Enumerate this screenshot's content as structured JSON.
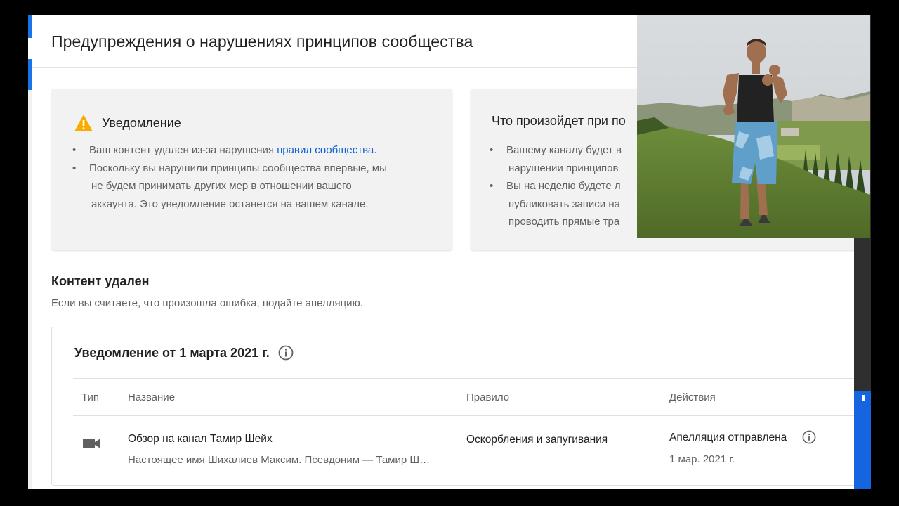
{
  "dialog": {
    "title": "Предупреждения о нарушениях принципов сообщества"
  },
  "notice_card": {
    "heading": "Уведомление",
    "bullet1_prefix": "Ваш контент удален из-за нарушения ",
    "bullet1_link": "правил сообщества",
    "bullet1_suffix": ".",
    "bullet2_line1": "Поскольку вы нарушили принципы сообщества впервые, мы",
    "bullet2_line2": "не будем принимать других мер в отношении вашего",
    "bullet2_line3": "аккаунта. Это уведомление останется на вашем канале."
  },
  "what_card": {
    "heading": "Что произойдет при по",
    "bullet1_line1": "Вашему каналу будет в",
    "bullet1_line2": "нарушении принципов",
    "bullet2_line1": "Вы на неделю будете л",
    "bullet2_line2": "публиковать записи на",
    "bullet2_line3": "проводить прямые тра"
  },
  "removed_section": {
    "title": "Контент удален",
    "subtitle": "Если вы считаете, что произошла ошибка, подайте апелляцию."
  },
  "table": {
    "title": "Уведомление от 1 марта 2021 г.",
    "columns": [
      "Тип",
      "Название",
      "Правило",
      "Действия"
    ],
    "row": {
      "type_icon": "video-camera-icon",
      "name": "Обзор на канал Тамир Шейх",
      "description": "Настоящее имя Шихалиев Максим. Псевдоним — Тамир Ш…",
      "rule": "Оскорбления и запугивания",
      "action": "Апелляция отправлена",
      "action_date": "1 мар. 2021 г."
    }
  },
  "colors": {
    "link": "#065fd4",
    "warning": "#f9ab00",
    "accent_blue": "#1a73e8"
  },
  "overlay": {
    "icon": "webcam-photo-overlay"
  }
}
